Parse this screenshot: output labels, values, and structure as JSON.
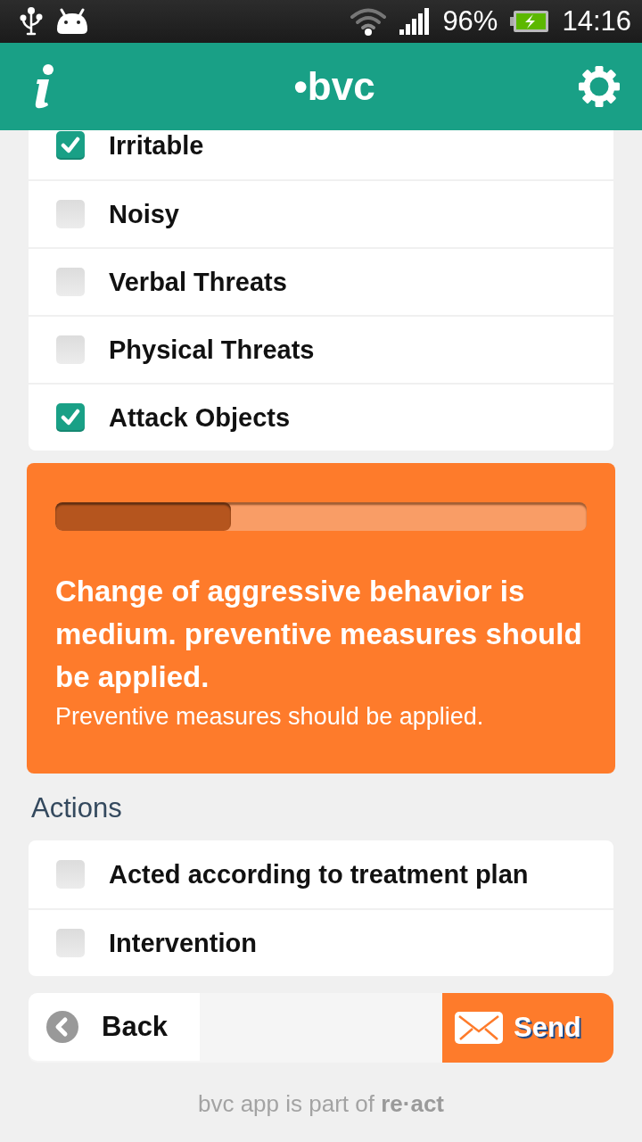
{
  "status_bar": {
    "battery": "96%",
    "time": "14:16"
  },
  "header": {
    "logo": "•bvc"
  },
  "symptoms": [
    {
      "label": "Irritable",
      "checked": true
    },
    {
      "label": "Noisy",
      "checked": false
    },
    {
      "label": "Verbal Threats",
      "checked": false
    },
    {
      "label": "Physical Threats",
      "checked": false
    },
    {
      "label": "Attack Objects",
      "checked": true
    }
  ],
  "risk_panel": {
    "level": 0.33,
    "headline": "Change of aggressive behavior is medium. preventive measures should be applied.",
    "detail": "Preventive measures should be applied."
  },
  "actions": {
    "title": "Actions",
    "items": [
      {
        "label": "Acted according to treatment plan",
        "checked": false
      },
      {
        "label": "Intervention",
        "checked": false
      }
    ]
  },
  "bottom_bar": {
    "back": "Back",
    "send": "Send"
  },
  "footer": "bvc app is part of **re·act**"
}
